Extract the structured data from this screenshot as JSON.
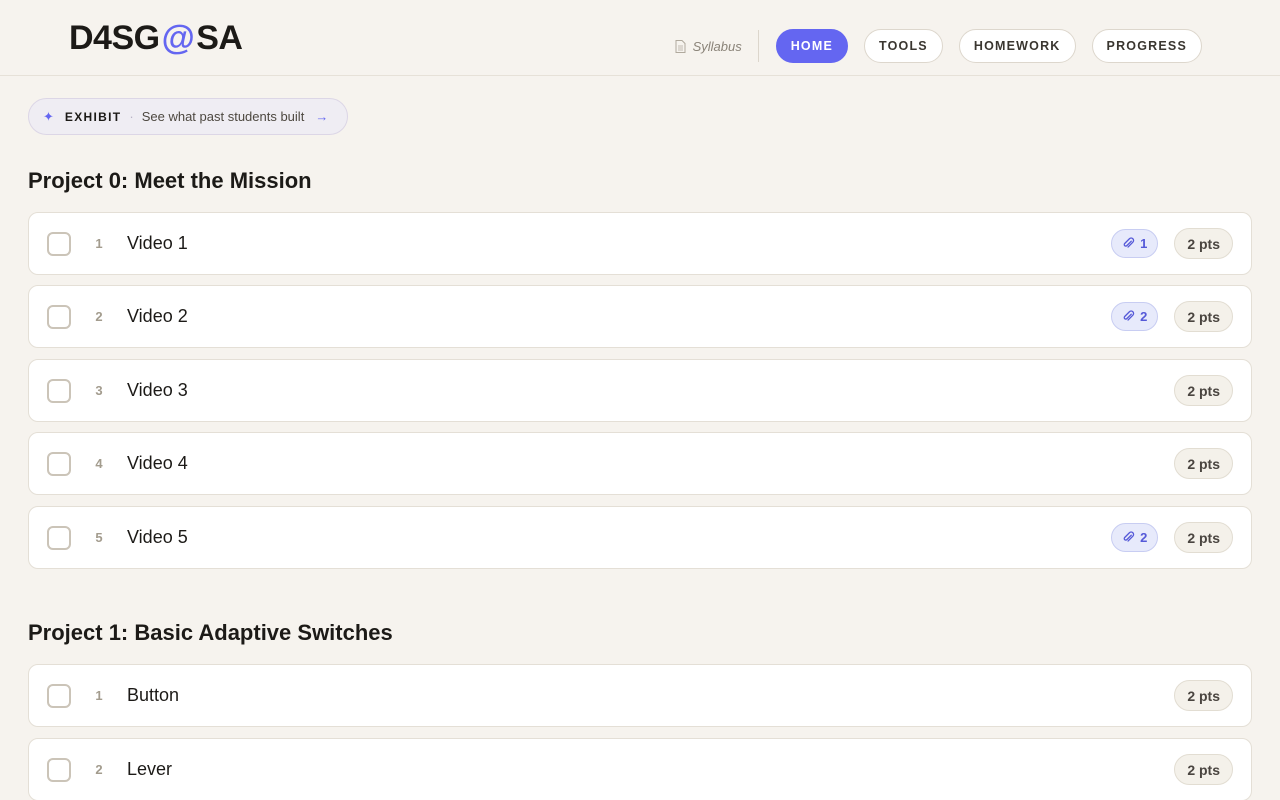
{
  "brand": {
    "left": "D4SG",
    "at": "@",
    "right": "SA"
  },
  "nav": {
    "syllabus": "Syllabus",
    "items": [
      {
        "label": "HOME",
        "active": true
      },
      {
        "label": "TOOLS",
        "active": false
      },
      {
        "label": "HOMEWORK",
        "active": false
      },
      {
        "label": "PROGRESS",
        "active": false
      }
    ]
  },
  "exhibit": {
    "label": "EXHIBIT",
    "separator": "·",
    "text": "See what past students built"
  },
  "colors": {
    "accent": "#6466f1",
    "background": "#f6f3ee"
  },
  "projects": [
    {
      "title": "Project 0: Meet the Mission",
      "tasks": [
        {
          "num": "1",
          "title": "Video 1",
          "attachments": "1",
          "points": "2 pts"
        },
        {
          "num": "2",
          "title": "Video 2",
          "attachments": "2",
          "points": "2 pts"
        },
        {
          "num": "3",
          "title": "Video 3",
          "points": "2 pts"
        },
        {
          "num": "4",
          "title": "Video 4",
          "points": "2 pts"
        },
        {
          "num": "5",
          "title": "Video 5",
          "attachments": "2",
          "points": "2 pts"
        }
      ]
    },
    {
      "title": "Project 1: Basic Adaptive Switches",
      "tasks": [
        {
          "num": "1",
          "title": "Button",
          "points": "2 pts"
        },
        {
          "num": "2",
          "title": "Lever",
          "points": "2 pts"
        }
      ]
    }
  ]
}
